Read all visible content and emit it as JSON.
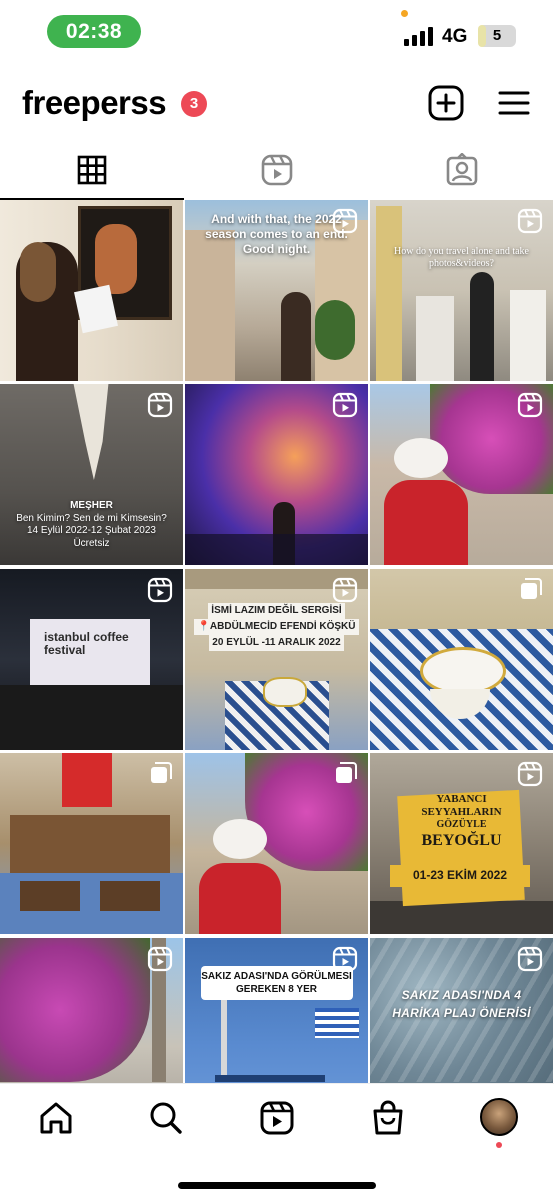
{
  "status_bar": {
    "time": "02:38",
    "network": "4G",
    "battery_level": "5",
    "battery_fraction": 0.05,
    "time_pill_color": "#3fb34f"
  },
  "header": {
    "username": "freeperss",
    "notification_count": "3",
    "badge_color": "#ed4956",
    "icons": [
      "new-post-icon",
      "menu-icon"
    ]
  },
  "tabs": [
    {
      "id": "grid",
      "icon": "grid-icon",
      "selected": true
    },
    {
      "id": "reels",
      "icon": "reels-icon",
      "selected": false
    },
    {
      "id": "tagged",
      "icon": "tagged-icon",
      "selected": false
    }
  ],
  "posts": [
    {
      "badge": "none",
      "caption": ""
    },
    {
      "badge": "reel",
      "caption": "And with that, the 2022 season comes to an end. Good night."
    },
    {
      "badge": "reel",
      "caption": "How do you travel alone and take photos&videos?"
    },
    {
      "badge": "reel",
      "caption_lines": [
        "MEŞHER",
        "Ben Kimim? Sen de mi Kimsesin?",
        "14 Eylül 2022-12 Şubat 2023",
        "Ücretsiz"
      ]
    },
    {
      "badge": "reel",
      "caption": ""
    },
    {
      "badge": "reel",
      "caption": ""
    },
    {
      "badge": "reel",
      "caption": "istanbul coffee festival"
    },
    {
      "badge": "reel",
      "caption_lines": [
        "İSMİ LAZIM DEĞİL SERGİSİ",
        "📍ABDÜLMECİD EFENDİ KÖŞKÜ",
        "20 EYLÜL -11 ARALIK 2022"
      ]
    },
    {
      "badge": "multi",
      "caption": ""
    },
    {
      "badge": "multi",
      "caption": ""
    },
    {
      "badge": "multi",
      "caption": ""
    },
    {
      "badge": "reel",
      "caption_lines": [
        "YABANCI",
        "SEYYAHLARIN",
        "GÖZÜYLE",
        "BEYOĞLU",
        "01-23 EKİM 2022"
      ]
    },
    {
      "badge": "reel",
      "caption": ""
    },
    {
      "badge": "reel",
      "caption_lines": [
        "SAKIZ ADASI'NDA GÖRÜLMESI",
        "GEREKEN 8 YER"
      ]
    },
    {
      "badge": "reel",
      "caption_lines": [
        "SAKIZ ADASI'NDA 4",
        "HARİKA PLAJ ÖNERİSİ"
      ]
    }
  ],
  "bottom_nav": [
    {
      "id": "home",
      "icon": "home-icon"
    },
    {
      "id": "search",
      "icon": "search-icon"
    },
    {
      "id": "reels",
      "icon": "reels-icon"
    },
    {
      "id": "shop",
      "icon": "shop-bag-icon"
    },
    {
      "id": "profile",
      "icon": "profile-avatar"
    }
  ]
}
